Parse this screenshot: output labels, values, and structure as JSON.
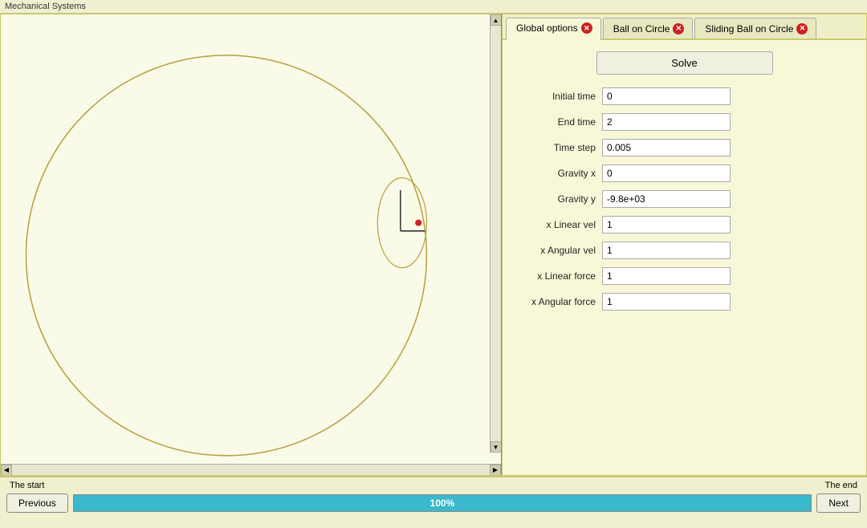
{
  "window": {
    "title": "Mechanical Systems"
  },
  "tabs": [
    {
      "id": "global",
      "label": "Global options",
      "active": true
    },
    {
      "id": "ball",
      "label": "Ball on Circle",
      "active": false
    },
    {
      "id": "sliding",
      "label": "Sliding Ball on Circle",
      "active": false
    }
  ],
  "solve_button": "Solve",
  "fields": [
    {
      "label": "Initial time",
      "value": "0"
    },
    {
      "label": "End time",
      "value": "2"
    },
    {
      "label": "Time step",
      "value": "0.005"
    },
    {
      "label": "Gravity x",
      "value": "0"
    },
    {
      "label": "Gravity y",
      "value": "-9.8e+03"
    },
    {
      "label": "x Linear vel",
      "value": "1"
    },
    {
      "label": "x Angular vel",
      "value": "1"
    },
    {
      "label": "x Linear force",
      "value": "1"
    },
    {
      "label": "x Angular force",
      "value": "1"
    }
  ],
  "bottom": {
    "start_label": "The start",
    "end_label": "The end",
    "prev_label": "Previous",
    "next_label": "Next",
    "progress_pct": 100,
    "progress_text": "100%"
  }
}
